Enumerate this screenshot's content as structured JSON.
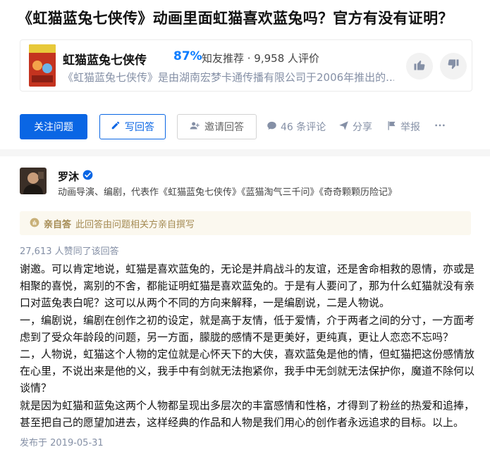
{
  "question": {
    "title": "《虹猫蓝兔七侠传》动画里面虹猫喜欢蓝兔吗？官方有没有证明？"
  },
  "topic": {
    "name": "虹猫蓝兔七侠传",
    "percent": "87%",
    "meta": "知友推荐 · 9,958 人评价",
    "description": "《虹猫蓝兔七侠传》是由湖南宏梦卡通传播有限公司于2006年推出的...",
    "cover_color": "#c4331f"
  },
  "actions": {
    "follow_label": "关注问题",
    "write_label": "写回答",
    "invite_label": "邀请回答",
    "comments_label": "46 条评论",
    "share_label": "分享",
    "report_label": "举报",
    "more_icon": "more-dots-icon"
  },
  "answer": {
    "author_name": "罗沐",
    "author_bio": "动画导演、编剧，代表作《虹猫蓝兔七侠传》《蓝猫淘气三千问》《奇奇颗颗历险记》",
    "self_answer_label": "亲自答",
    "self_answer_text": "此回答由问题相关方亲自撰写",
    "likes": "27,613 人赞同了该回答",
    "paragraphs": [
      "谢邀。可以肯定地说，虹猫是喜欢蓝兔的，无论是并肩战斗的友谊，还是舍命相救的恩情，亦或是相聚的喜悦，离别的不舍，都能证明虹猫是喜欢蓝兔的。于是有人要问了，那为什么虹猫就没有亲口对蓝兔表白呢？这可以从两个不同的方向来解释，一是编剧说，二是人物说。",
      "一，编剧说，编剧在创作之初的设定，就是高于友情，低于爱情，介于两者之间的分寸，一方面考虑到了受众年龄段的问题，另一方面，朦胧的感情不是更美好，更纯真，更让人恋恋不忘吗？",
      "二，人物说，虹猫这个人物的定位就是心怀天下的大侠，喜欢蓝兔是他的情，但虹猫把这份感情放在心里，不说出来是他的义，我手中有剑就无法抱紧你，我手中无剑就无法保护你，魔道不除何以谈情？",
      "就是因为虹猫和蓝兔这两个人物都呈现出多层次的丰富感情和性格，才得到了粉丝的热爱和追捧，甚至把自己的愿望加进去，这样经典的作品和人物是我们用心的创作者永远追求的目标。以上。"
    ],
    "publish_date": "发布于 2019-05-31"
  },
  "colors": {
    "accent": "#0a66e4",
    "percent": "#0a7cff",
    "muted": "#8590a6",
    "self_answer_bg": "#fbf8ef",
    "self_answer_text": "#a48a52"
  }
}
